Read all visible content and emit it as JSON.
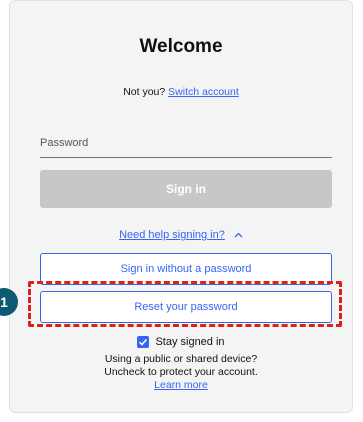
{
  "header": {
    "title": "Welcome"
  },
  "account": {
    "not_you_label": "Not you?",
    "switch_account_label": "Switch account"
  },
  "form": {
    "password_placeholder": "Password",
    "signin_label": "Sign in",
    "help_label": "Need help signing in?",
    "help_caret": "^",
    "signin_without_password_label": "Sign in without a password",
    "reset_password_label": "Reset your password",
    "stay_signed_in_label": "Stay signed in",
    "stay_signed_in_checked": true
  },
  "info": {
    "line1": "Using a public or shared device?",
    "line2": "Uncheck to protect your account.",
    "learn_more": "Learn more"
  },
  "annotation": {
    "step_number": "1",
    "highlight_color": "#e01e1e",
    "badge_color": "#0d5b72"
  },
  "colors": {
    "accent": "#3665f3",
    "disabled_button": "#c7c7c7",
    "card_background": "#f4f4f4"
  }
}
